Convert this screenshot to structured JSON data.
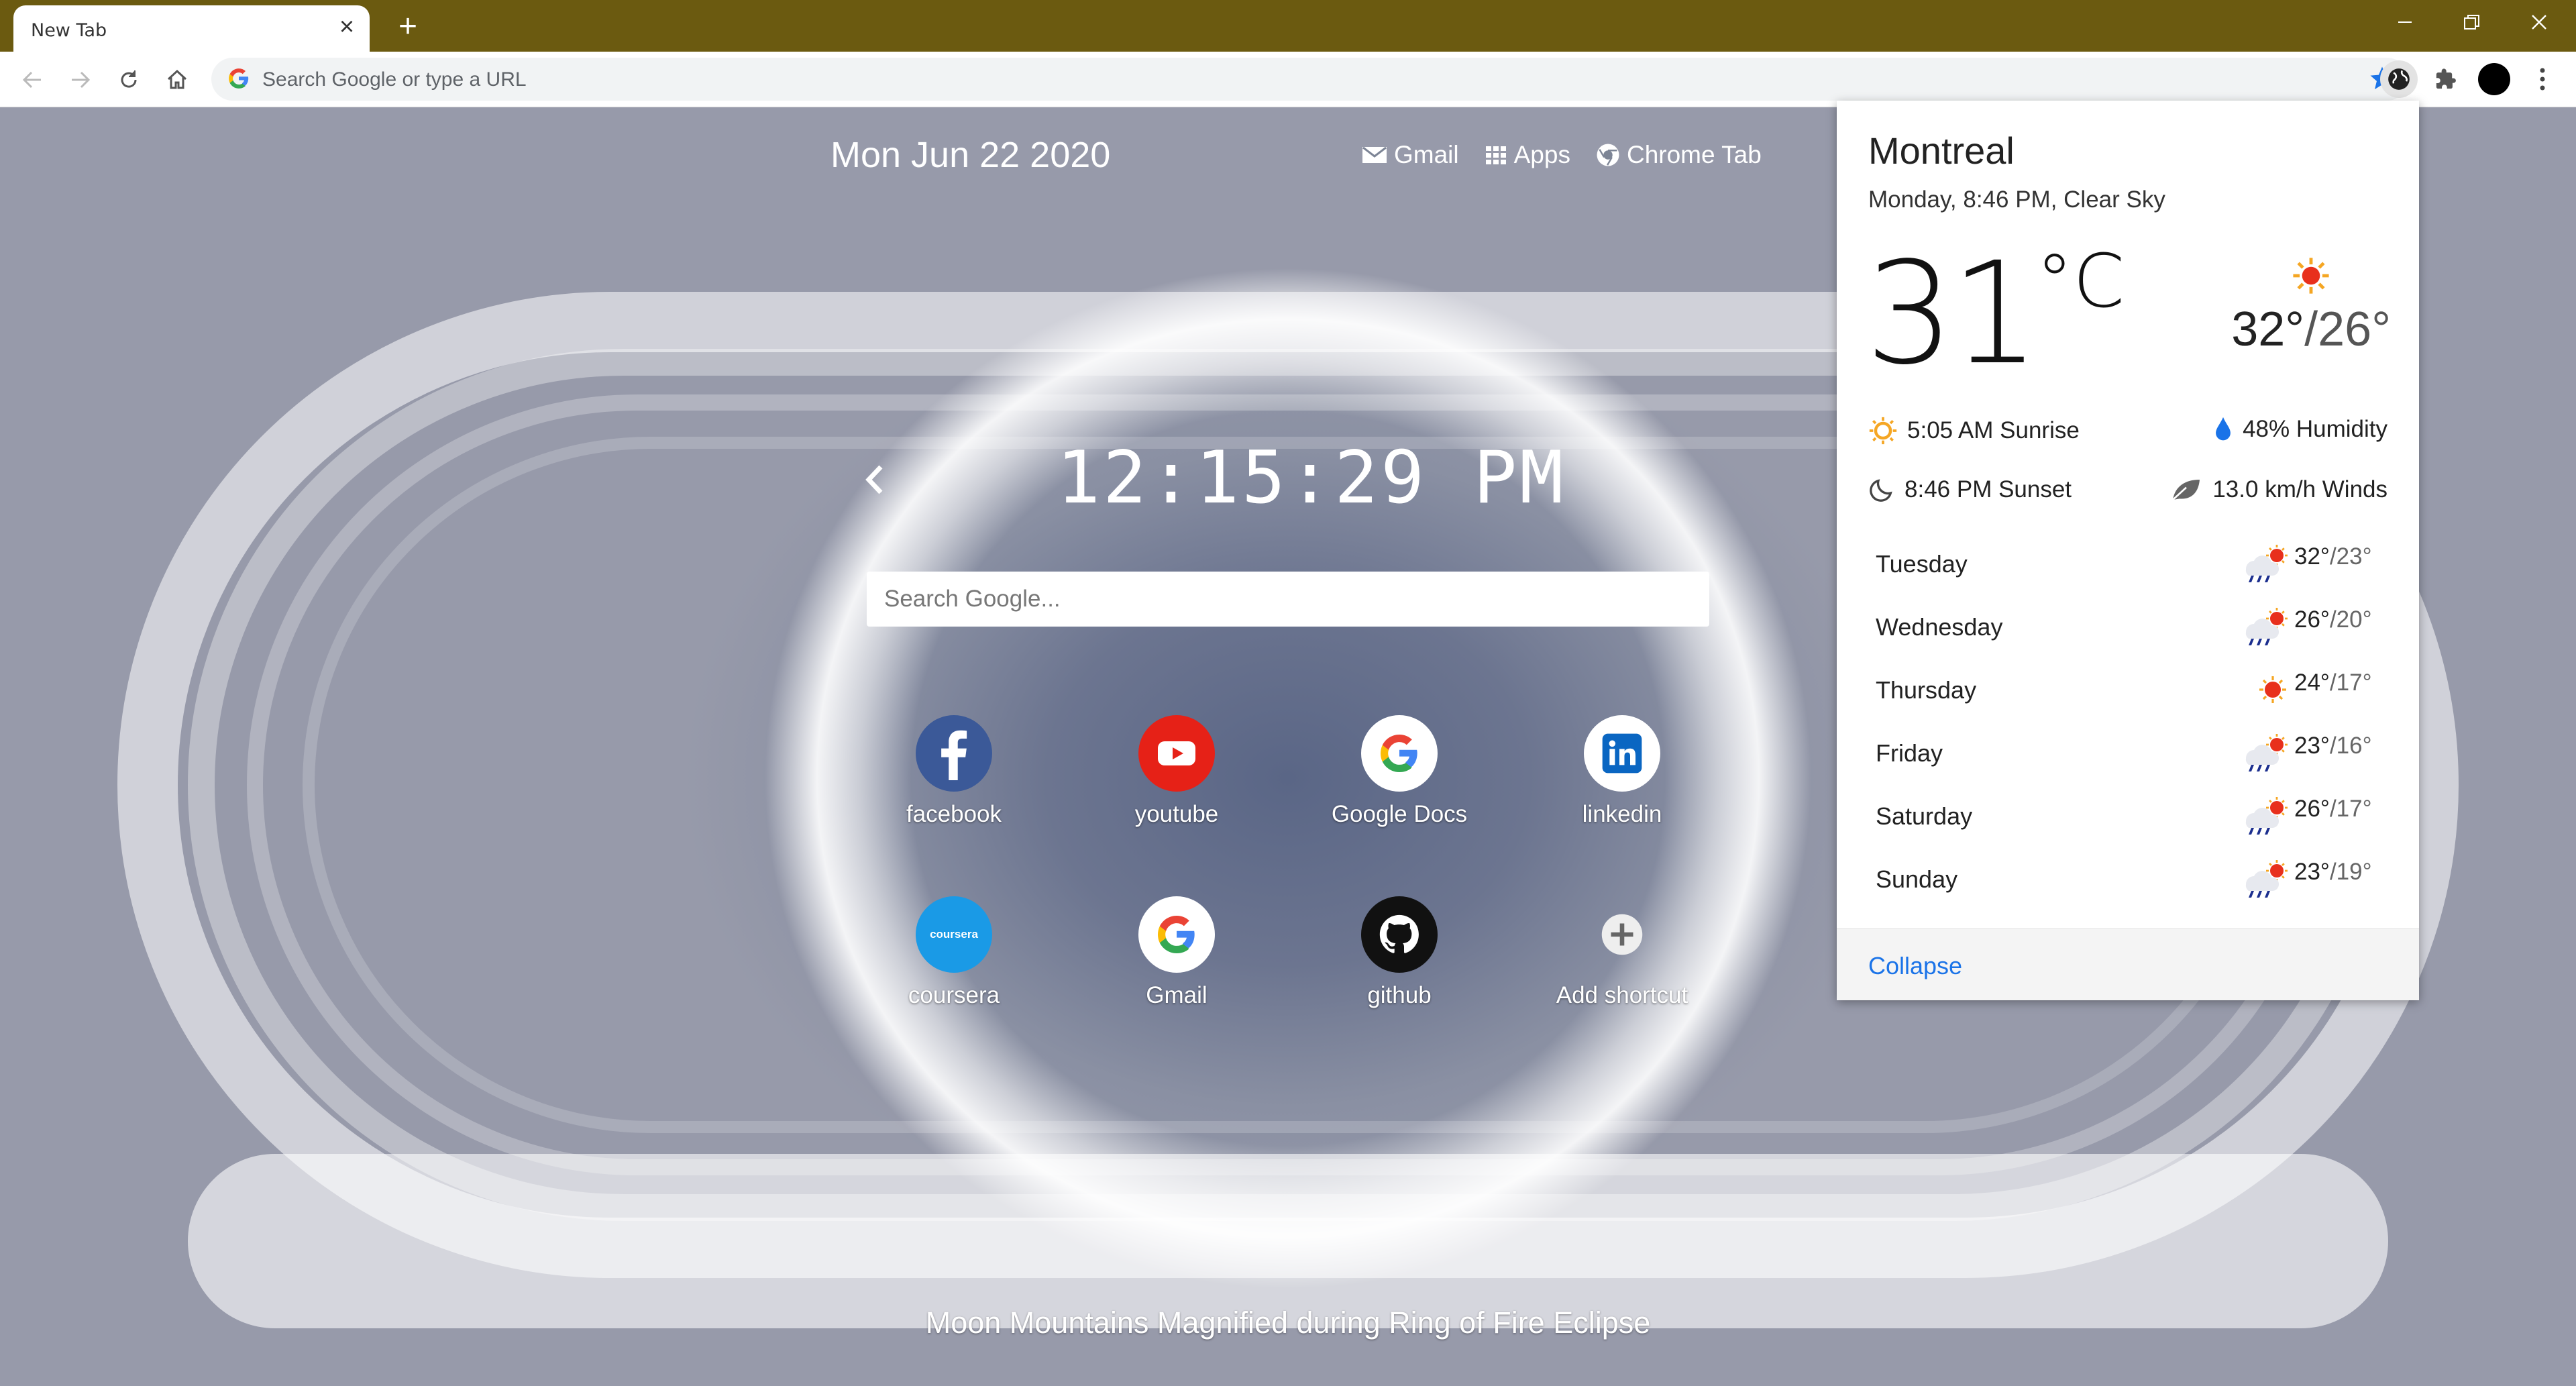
{
  "browser": {
    "tab_title": "New Tab",
    "omnibox_placeholder": "Search Google or type a URL"
  },
  "page": {
    "date": "Mon Jun 22 2020",
    "links": [
      {
        "label": "Gmail",
        "icon": "mail-icon"
      },
      {
        "label": "Apps",
        "icon": "apps-grid-icon"
      },
      {
        "label": "Chrome Tab",
        "icon": "chrome-icon"
      }
    ],
    "clock": "12:15:29 PM",
    "search_placeholder": "Search Google...",
    "shortcuts": [
      {
        "label": "facebook",
        "icon": "facebook-icon"
      },
      {
        "label": "youtube",
        "icon": "youtube-icon"
      },
      {
        "label": "Google Docs",
        "icon": "google-icon"
      },
      {
        "label": "linkedin",
        "icon": "linkedin-icon"
      },
      {
        "label": "coursera",
        "icon": "coursera-icon",
        "icon_text": "coursera"
      },
      {
        "label": "Gmail",
        "icon": "google-icon"
      },
      {
        "label": "github",
        "icon": "github-icon"
      },
      {
        "label": "Add shortcut",
        "icon": "plus-icon"
      }
    ],
    "caption": "Moon Mountains Magnified during Ring of Fire Eclipse"
  },
  "weather": {
    "city": "Montreal",
    "subtitle": "Monday, 8:46 PM, Clear Sky",
    "temp_value": "31",
    "temp_unit": "°C",
    "high": "32°",
    "low": "/26°",
    "sunrise": "5:05 AM Sunrise",
    "humidity": "48% Humidity",
    "sunset": "8:46 PM Sunset",
    "winds": "13.0 km/h Winds",
    "forecast": [
      {
        "day": "Tuesday",
        "high": "32°",
        "low": "/23°",
        "icon": "rain-sun-icon"
      },
      {
        "day": "Wednesday",
        "high": "26°",
        "low": "/20°",
        "icon": "rain-sun-icon"
      },
      {
        "day": "Thursday",
        "high": "24°",
        "low": "/17°",
        "icon": "sun-icon"
      },
      {
        "day": "Friday",
        "high": "23°",
        "low": "/16°",
        "icon": "rain-sun-icon"
      },
      {
        "day": "Saturday",
        "high": "26°",
        "low": "/17°",
        "icon": "rain-sun-icon"
      },
      {
        "day": "Sunday",
        "high": "23°",
        "low": "/19°",
        "icon": "rain-sun-icon"
      }
    ],
    "collapse_label": "Collapse"
  },
  "colors": {
    "tabstrip": "#6b5a10",
    "link_blue": "#1a73e8",
    "sun_red": "#e8301c"
  }
}
